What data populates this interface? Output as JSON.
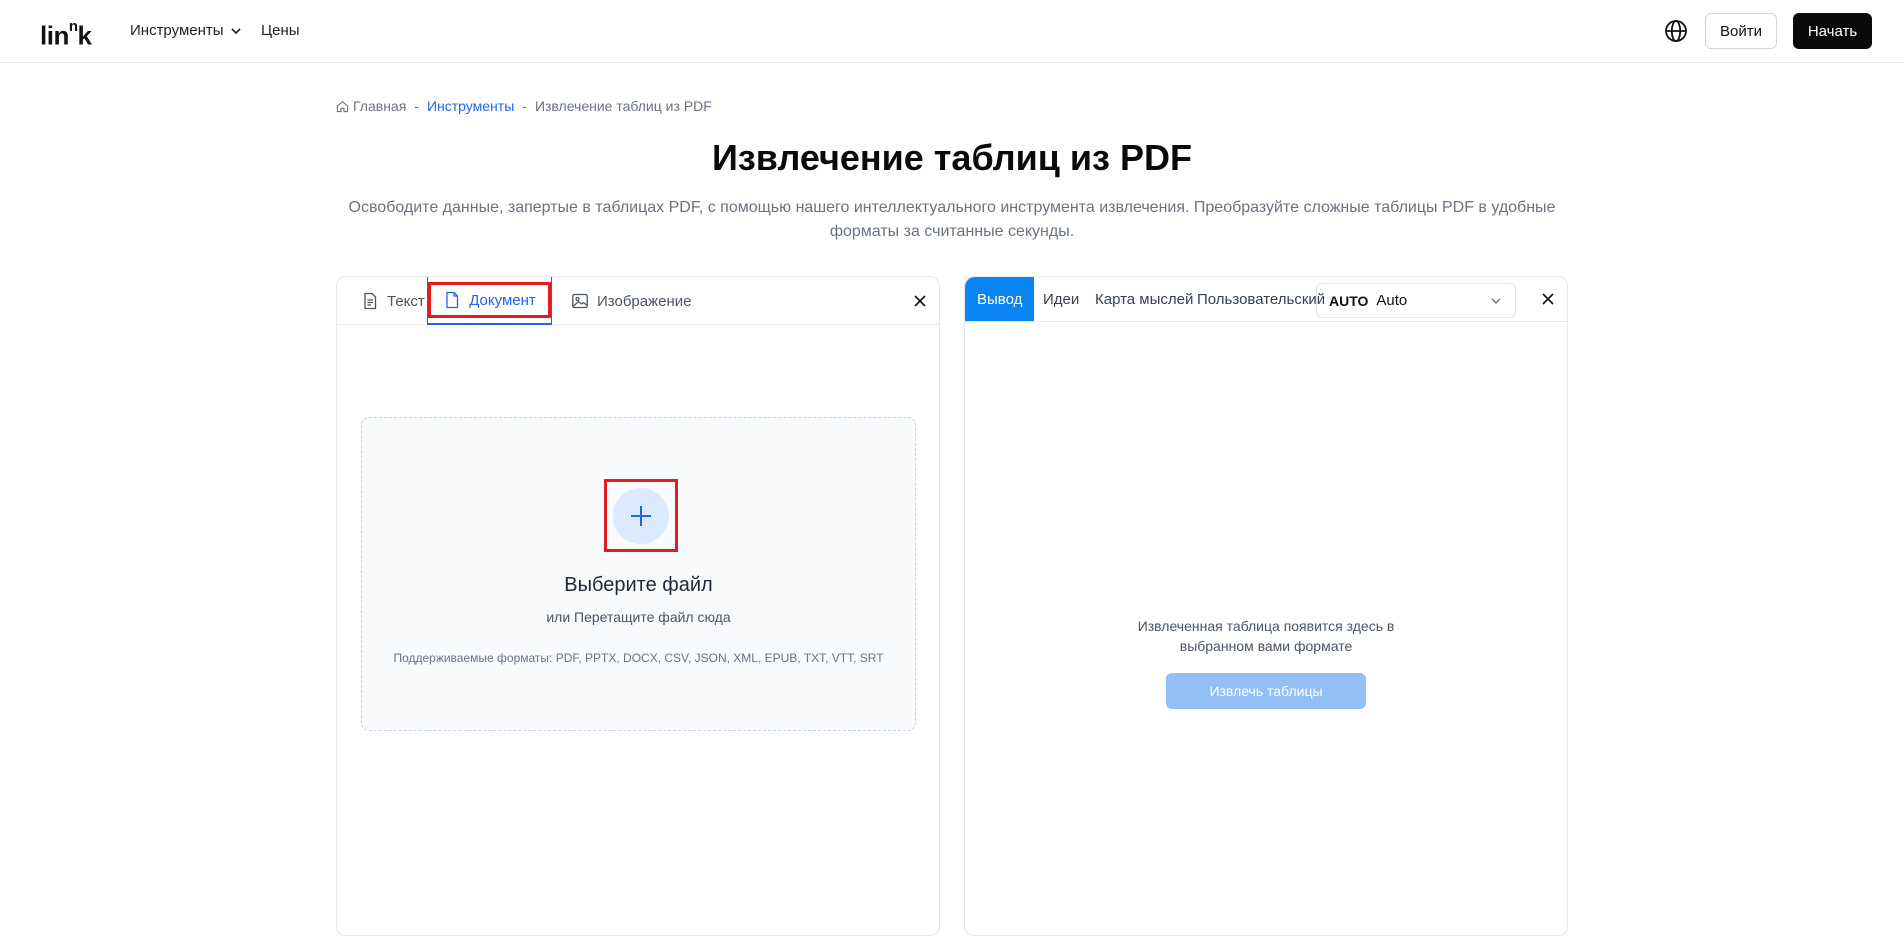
{
  "header": {
    "logo_main": "lin",
    "logo_sup": "n",
    "logo_end": "k",
    "nav": {
      "tools": "Инструменты",
      "prices": "Цены"
    },
    "login": "Войти",
    "start": "Начать"
  },
  "breadcrumb": {
    "home": "Главная",
    "tools": "Инструменты",
    "current": "Извлечение таблиц из PDF",
    "separator": "-"
  },
  "page": {
    "title": "Извлечение таблиц из PDF",
    "subtitle": "Освободите данные, запертые в таблицах PDF, с помощью нашего интеллектуального инструмента извлечения. Преобразуйте сложные таблицы PDF в удобные форматы за считанные секунды."
  },
  "input_panel": {
    "tabs": {
      "text": "Текст",
      "document": "Документ",
      "image": "Изображение"
    },
    "active_tab": "document",
    "dropzone": {
      "title": "Выберите файл",
      "subtitle": "или Перетащите файл сюда",
      "formats": "Поддерживаемые форматы: PDF, PPTX, DOCX, CSV, JSON, XML, EPUB, TXT, VTT, SRT"
    }
  },
  "output_panel": {
    "tabs": {
      "output": "Вывод",
      "ideas": "Идеи",
      "mindmap": "Карта мыслей",
      "custom": "Пользовательский"
    },
    "active_tab": "output",
    "model_select": {
      "tag": "AUTO",
      "value": "Auto"
    },
    "empty_line1": "Извлеченная таблица появится здесь в",
    "empty_line2": "выбранном вами формате",
    "extract_button": "Извлечь таблицы"
  },
  "colors": {
    "accent": "#0b84f3",
    "link": "#2563eb",
    "highlight": "#e11d1d",
    "extract_disabled": "#93bff5"
  }
}
